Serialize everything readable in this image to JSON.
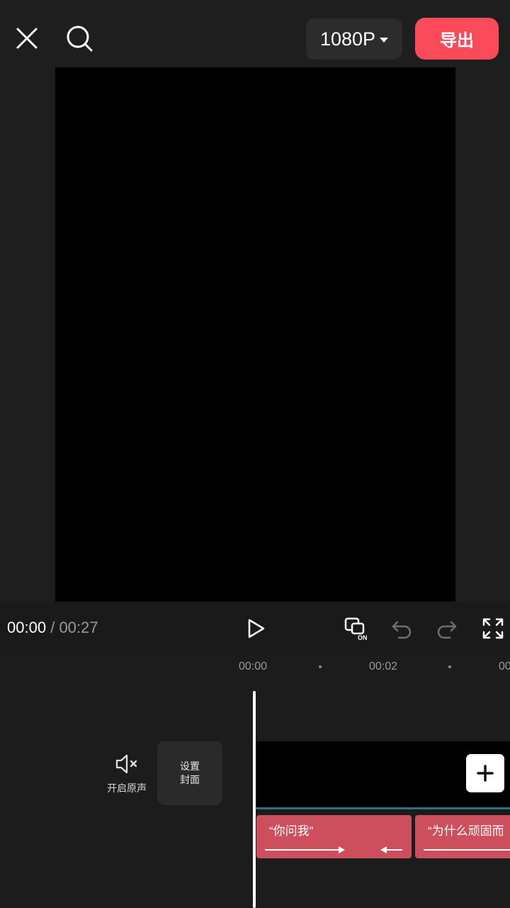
{
  "topbar": {
    "resolution_label": "1080P",
    "export_label": "导出"
  },
  "playback": {
    "current_time": "00:00",
    "separator": "/",
    "total_time": "00:27"
  },
  "ruler": {
    "ticks": [
      "00:00",
      "00:02",
      "00"
    ]
  },
  "side_controls": {
    "mute_label": "开启原声",
    "cover_line1": "设置",
    "cover_line2": "封面"
  },
  "text_clips": [
    {
      "text": "“你问我”"
    },
    {
      "text": "“为什么顽固而"
    }
  ],
  "colors": {
    "export": "#fb4a5a",
    "text_clip": "#cd4e5c",
    "track_line": "#2d6f8a"
  },
  "icons": [
    "close-icon",
    "search-icon",
    "chevron-down-icon",
    "link-on-icon",
    "undo-icon",
    "redo-icon",
    "fullscreen-icon",
    "play-icon",
    "mute-icon",
    "plus-icon"
  ]
}
